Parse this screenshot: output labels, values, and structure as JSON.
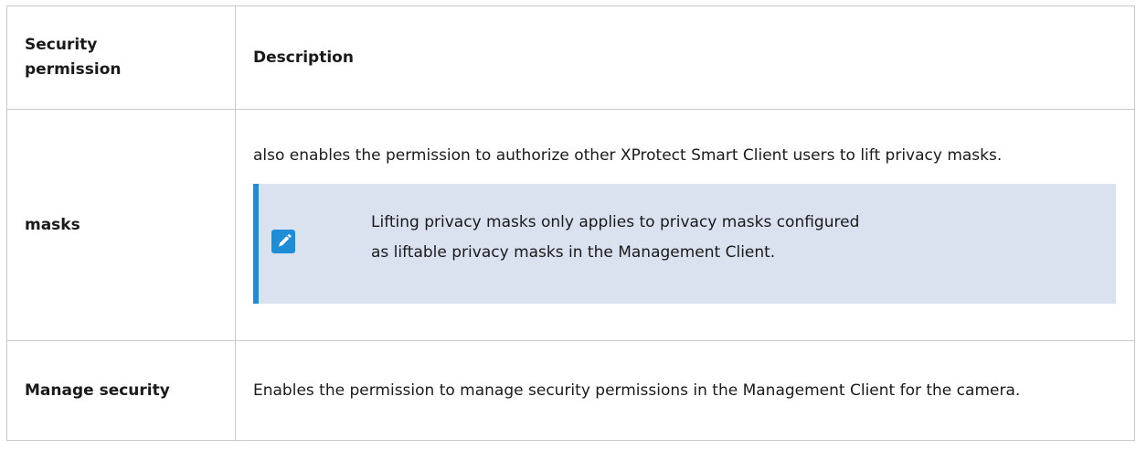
{
  "table": {
    "headers": {
      "permission": "Security permission",
      "description": "Description"
    },
    "rows": [
      {
        "permission": "masks",
        "description": "also enables the permission to authorize other XProtect Smart Client users to lift privacy masks.",
        "note": {
          "icon": "pencil-icon",
          "text_line1": "Lifting privacy masks only applies to privacy masks configured",
          "text_line2": "as liftable privacy masks in the Management Client."
        }
      },
      {
        "permission": "Manage security",
        "description": "Enables the permission to manage security permissions in the Management Client for the camera."
      }
    ]
  },
  "colors": {
    "border": "#c9c9c9",
    "note_background": "#dae2f0",
    "note_accent": "#1d8dd6"
  }
}
